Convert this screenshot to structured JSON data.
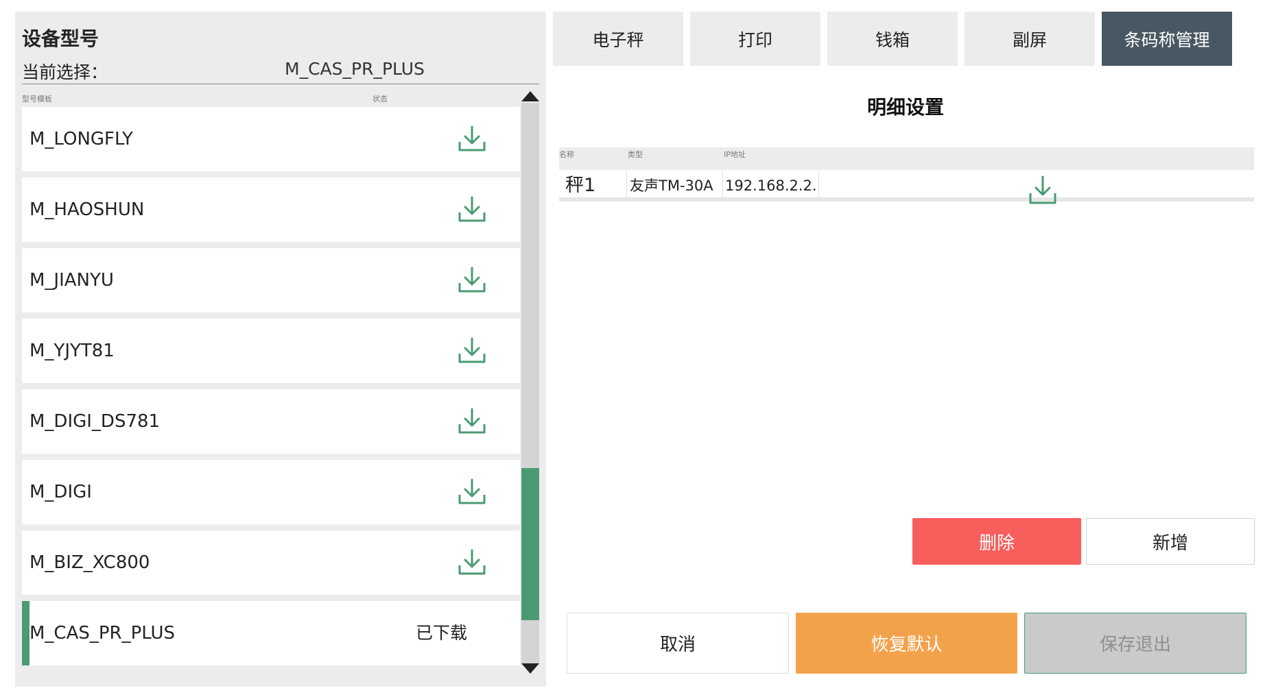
{
  "device_panel": {
    "title": "设备型号",
    "current_label": "当前选择：",
    "current_value": "M_CAS_PR_PLUS",
    "col_model": "型号模板",
    "col_status": "状态",
    "models": [
      {
        "name": "M_LONGFLY",
        "status": "",
        "icon": "download-icon"
      },
      {
        "name": "M_HAOSHUN",
        "status": "",
        "icon": "download-icon"
      },
      {
        "name": "M_JIANYU",
        "status": "",
        "icon": "download-icon"
      },
      {
        "name": "M_YJYT81",
        "status": "",
        "icon": "download-icon"
      },
      {
        "name": "M_DIGI_DS781",
        "status": "",
        "icon": "download-icon"
      },
      {
        "name": "M_DIGI",
        "status": "",
        "icon": "download-icon"
      },
      {
        "name": "M_BIZ_XC800",
        "status": "",
        "icon": "download-icon"
      },
      {
        "name": "M_CAS_PR_PLUS",
        "status": "已下载",
        "icon": ""
      }
    ]
  },
  "tabs": [
    {
      "label": "电子秤",
      "active": false
    },
    {
      "label": "打印",
      "active": false
    },
    {
      "label": "钱箱",
      "active": false
    },
    {
      "label": "副屏",
      "active": false
    },
    {
      "label": "条码称管理",
      "active": true
    }
  ],
  "detail": {
    "title": "明细设置",
    "columns": [
      "名称",
      "类型",
      "IP地址"
    ],
    "rows": [
      {
        "name": "秤1",
        "type": "友声TM-30A",
        "ip": "192.168.2.2..."
      }
    ]
  },
  "buttons": {
    "delete": "删除",
    "add": "新增",
    "cancel": "取消",
    "restore": "恢复默认",
    "save": "保存退出"
  },
  "colors": {
    "accent_green": "#4a9a72",
    "active_tab": "#485862",
    "delete": "#f85e5c",
    "restore": "#f3a24c",
    "save_disabled": "#cacaca"
  }
}
